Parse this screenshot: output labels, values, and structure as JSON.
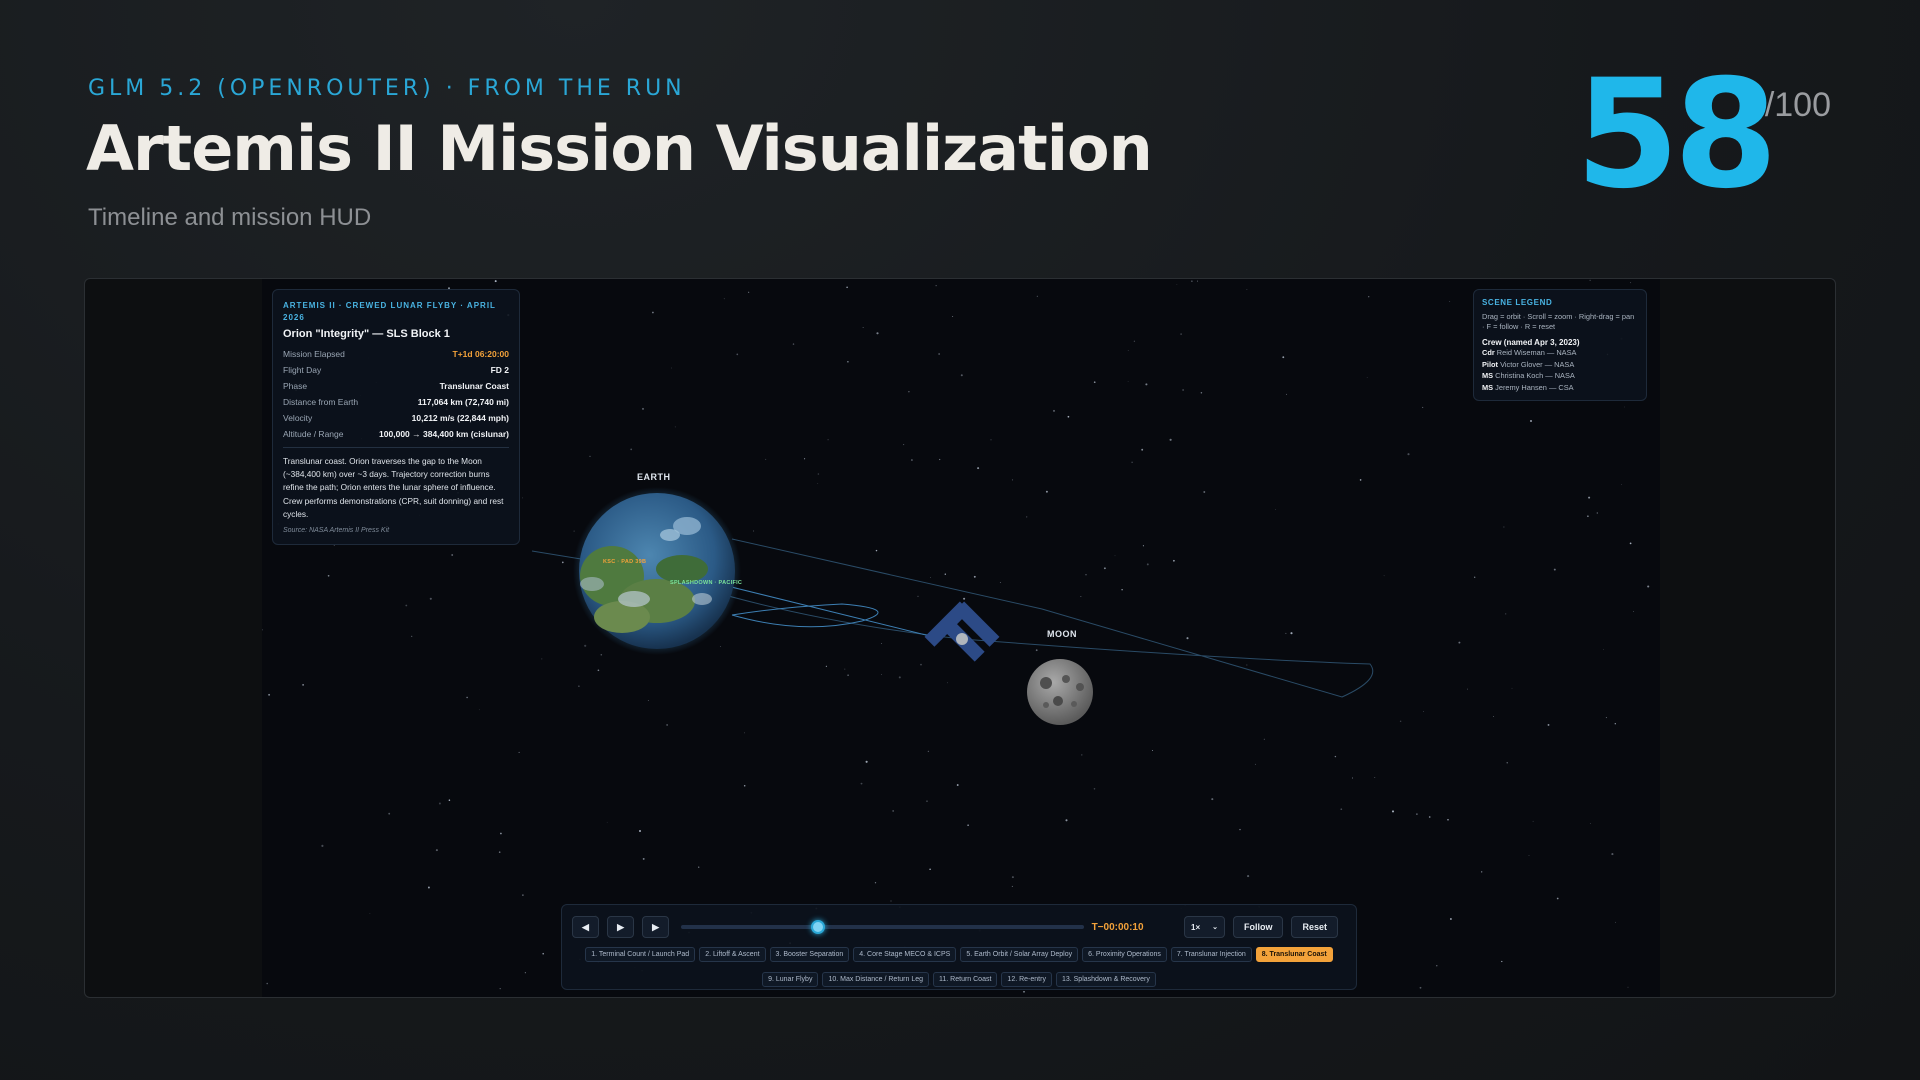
{
  "header": {
    "eyebrow": "GLM 5.2 (OPENROUTER) · FROM THE RUN",
    "title": "Artemis II Mission Visualization",
    "subtitle": "Timeline and mission HUD",
    "score": "58",
    "score_denominator": "/100"
  },
  "mission_panel": {
    "kicker": "ARTEMIS II · CREWED LUNAR FLYBY · APRIL 2026",
    "title": "Orion \"Integrity\" — SLS Block 1",
    "stats": [
      {
        "label": "Mission Elapsed",
        "value": "T+1d 06:20:00",
        "highlight": true
      },
      {
        "label": "Flight Day",
        "value": "FD 2"
      },
      {
        "label": "Phase",
        "value": "Translunar Coast"
      },
      {
        "label": "Distance from Earth",
        "value": "117,064 km (72,740 mi)"
      },
      {
        "label": "Velocity",
        "value": "10,212 m/s (22,844 mph)"
      },
      {
        "label": "Altitude / Range",
        "value": "100,000 → 384,400 km (cislunar)"
      }
    ],
    "description": "Translunar coast. Orion traverses the gap to the Moon (~384,400 km) over ~3 days. Trajectory correction burns refine the path; Orion enters the lunar sphere of influence. Crew performs demonstrations (CPR, suit donning) and rest cycles.",
    "source": "Source: NASA Artemis II Press Kit"
  },
  "legend": {
    "kicker": "SCENE LEGEND",
    "hint": "Drag = orbit · Scroll = zoom · Right-drag = pan · F = follow · R = reset",
    "crew_heading": "Crew (named Apr 3, 2023)",
    "crew": [
      {
        "role": "Cdr",
        "name": "Reid Wiseman — NASA"
      },
      {
        "role": "Pilot",
        "name": "Victor Glover — NASA"
      },
      {
        "role": "MS",
        "name": "Christina Koch — NASA"
      },
      {
        "role": "MS",
        "name": "Jeremy Hansen — CSA"
      }
    ]
  },
  "scene": {
    "earth_label": "EARTH",
    "moon_label": "MOON",
    "ksc_label": "KSC · PAD 39B",
    "splashdown_label": "SPLASHDOWN · PACIFIC"
  },
  "controls": {
    "prev_icon": "step-back-icon",
    "play_icon": "play-icon",
    "next_icon": "step-forward-icon",
    "timeline_progress": 0.34,
    "clock": "T−00:00:10",
    "speed": "1×",
    "follow_label": "Follow",
    "reset_label": "Reset",
    "phases": [
      "1. Terminal Count / Launch Pad",
      "2. Liftoff & Ascent",
      "3. Booster Separation",
      "4. Core Stage MECO & ICPS",
      "5. Earth Orbit / Solar Array Deploy",
      "6. Proximity Operations",
      "7. Translunar Injection",
      "8. Translunar Coast",
      "9. Lunar Flyby",
      "10. Max Distance / Return Leg",
      "11. Return Coast",
      "12. Re-entry",
      "13. Splashdown & Recovery"
    ],
    "active_phase_index": 7
  },
  "colors": {
    "accent": "#1fb7ea",
    "highlight": "#f3a23a",
    "background": "#07090e"
  }
}
